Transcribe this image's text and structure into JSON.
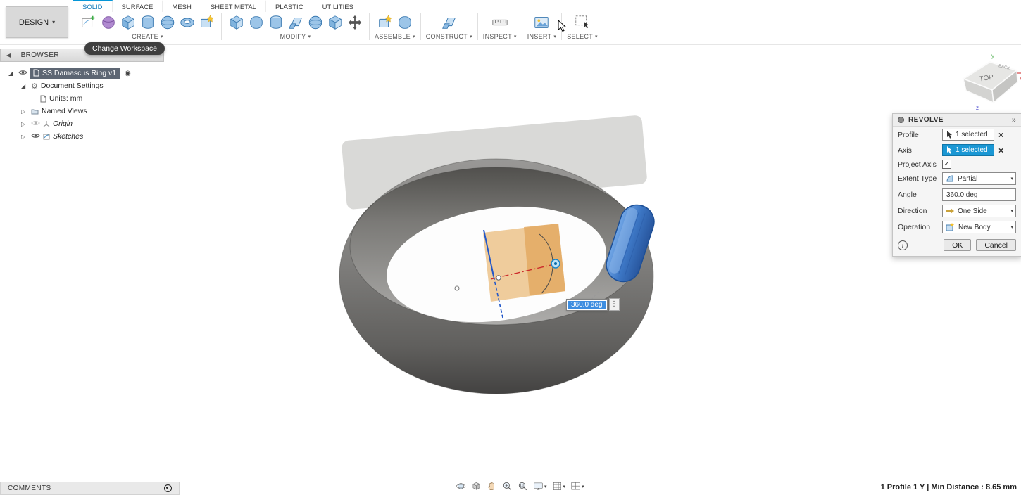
{
  "header": {
    "workspace_button": "DESIGN",
    "tooltip": "Change Workspace",
    "tabs": [
      {
        "label": "SOLID",
        "active": true
      },
      {
        "label": "SURFACE",
        "active": false
      },
      {
        "label": "MESH",
        "active": false
      },
      {
        "label": "SHEET METAL",
        "active": false
      },
      {
        "label": "PLASTIC",
        "active": false
      },
      {
        "label": "UTILITIES",
        "active": false
      }
    ]
  },
  "toolbar": {
    "groups": [
      {
        "label": "CREATE",
        "icons": [
          {
            "name": "create-sketch",
            "kind": "sketch"
          },
          {
            "name": "create-form",
            "kind": "purple"
          },
          {
            "name": "create-box",
            "kind": "box"
          },
          {
            "name": "create-cylinder",
            "kind": "cylinder"
          },
          {
            "name": "create-sphere",
            "kind": "sphere"
          },
          {
            "name": "create-torus",
            "kind": "torus"
          },
          {
            "name": "create-pattern",
            "kind": "star"
          }
        ]
      },
      {
        "label": "MODIFY",
        "icons": [
          {
            "name": "press-pull",
            "kind": "box"
          },
          {
            "name": "fillet",
            "kind": "round"
          },
          {
            "name": "shell",
            "kind": "cylinder"
          },
          {
            "name": "draft",
            "kind": "plane"
          },
          {
            "name": "scale",
            "kind": "sphere"
          },
          {
            "name": "combine",
            "kind": "box"
          },
          {
            "name": "move-copy",
            "kind": "cross"
          }
        ]
      },
      {
        "label": "ASSEMBLE",
        "icons": [
          {
            "name": "new-component",
            "kind": "star"
          },
          {
            "name": "joint",
            "kind": "round"
          }
        ]
      },
      {
        "label": "CONSTRUCT",
        "icons": [
          {
            "name": "construction-plane",
            "kind": "plane"
          }
        ]
      },
      {
        "label": "INSPECT",
        "icons": [
          {
            "name": "measure",
            "kind": "ruler"
          }
        ]
      },
      {
        "label": "INSERT",
        "icons": [
          {
            "name": "insert-canvas",
            "kind": "canvas"
          }
        ]
      },
      {
        "label": "SELECT",
        "icons": [
          {
            "name": "select-window",
            "kind": "select"
          }
        ]
      }
    ]
  },
  "browser": {
    "header": "BROWSER",
    "root_label": "SS Damascus Ring v1",
    "items": [
      {
        "label": "Document Settings"
      },
      {
        "label": "Units: mm"
      },
      {
        "label": "Named Views"
      },
      {
        "label": "Origin"
      },
      {
        "label": "Sketches"
      }
    ]
  },
  "viewport": {
    "angle_value": "360.0 deg",
    "viewcube": {
      "top": "TOP",
      "back": "BACK",
      "x": "x",
      "y": "y",
      "z": "z"
    }
  },
  "revolve_dialog": {
    "title": "REVOLVE",
    "profile_label": "Profile",
    "profile_value": "1 selected",
    "axis_label": "Axis",
    "axis_value": "1 selected",
    "project_axis_label": "Project Axis",
    "extent_type_label": "Extent Type",
    "extent_type_value": "Partial",
    "angle_label": "Angle",
    "angle_value": "360.0 deg",
    "direction_label": "Direction",
    "direction_value": "One Side",
    "operation_label": "Operation",
    "operation_value": "New Body",
    "ok": "OK",
    "cancel": "Cancel"
  },
  "nav_bar": {
    "icons": [
      {
        "name": "orbit",
        "kind": "orbit",
        "caret": false
      },
      {
        "name": "look-at",
        "kind": "cube",
        "caret": false
      },
      {
        "name": "pan",
        "kind": "hand",
        "caret": false
      },
      {
        "name": "zoom",
        "kind": "magnifier",
        "caret": false
      },
      {
        "name": "fit",
        "kind": "fit",
        "caret": false
      },
      {
        "name": "display-settings",
        "kind": "monitor",
        "caret": true
      },
      {
        "name": "grid-display",
        "kind": "grid",
        "caret": true
      },
      {
        "name": "viewports",
        "kind": "viewports",
        "caret": true
      }
    ]
  },
  "comments": {
    "label": "COMMENTS"
  },
  "status_bar": {
    "text": "1 Profile 1 Y | Min Distance : 8.65 mm"
  }
}
